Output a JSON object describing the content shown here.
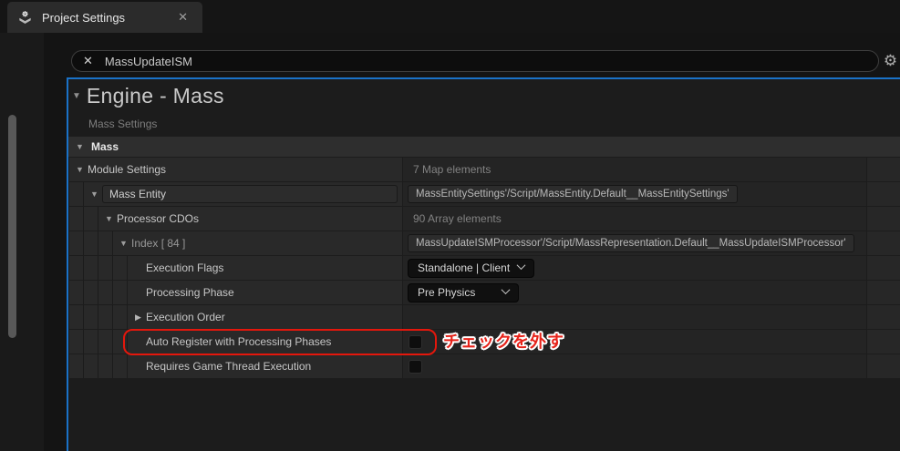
{
  "icons": {
    "collapse": "▼",
    "expand": "▶",
    "close": "✕",
    "clear": "✕",
    "gear": "⚙"
  },
  "window": {
    "tab_title": "Project Settings"
  },
  "search": {
    "value": "MassUpdateISM"
  },
  "page": {
    "title": "Engine - Mass",
    "subtitle": "Mass Settings"
  },
  "colors": {
    "accent_blue": "#1a72c8",
    "annotation_red": "#e4170c",
    "panel_bg": "#1c1c1c"
  },
  "rows": {
    "mass": {
      "label": "Mass"
    },
    "module_settings": {
      "label": "Module Settings",
      "value": "7 Map elements"
    },
    "mass_entity": {
      "label": "Mass Entity",
      "value": "MassEntitySettings'/Script/MassEntity.Default__MassEntitySettings'"
    },
    "processor_cdos": {
      "label": "Processor CDOs",
      "value": "90 Array elements"
    },
    "index_84": {
      "label": "Index [ 84 ]",
      "value": "MassUpdateISMProcessor'/Script/MassRepresentation.Default__MassUpdateISMProcessor'"
    },
    "execution_flags": {
      "label": "Execution Flags",
      "value": "Standalone | Client"
    },
    "processing_phase": {
      "label": "Processing Phase",
      "value": "Pre Physics"
    },
    "execution_order": {
      "label": "Execution Order"
    },
    "auto_register": {
      "label": "Auto Register with Processing Phases",
      "checked": false
    },
    "requires_game_thread": {
      "label": "Requires Game Thread Execution",
      "checked": false
    }
  },
  "annotation": {
    "text": "チェックを外す"
  }
}
